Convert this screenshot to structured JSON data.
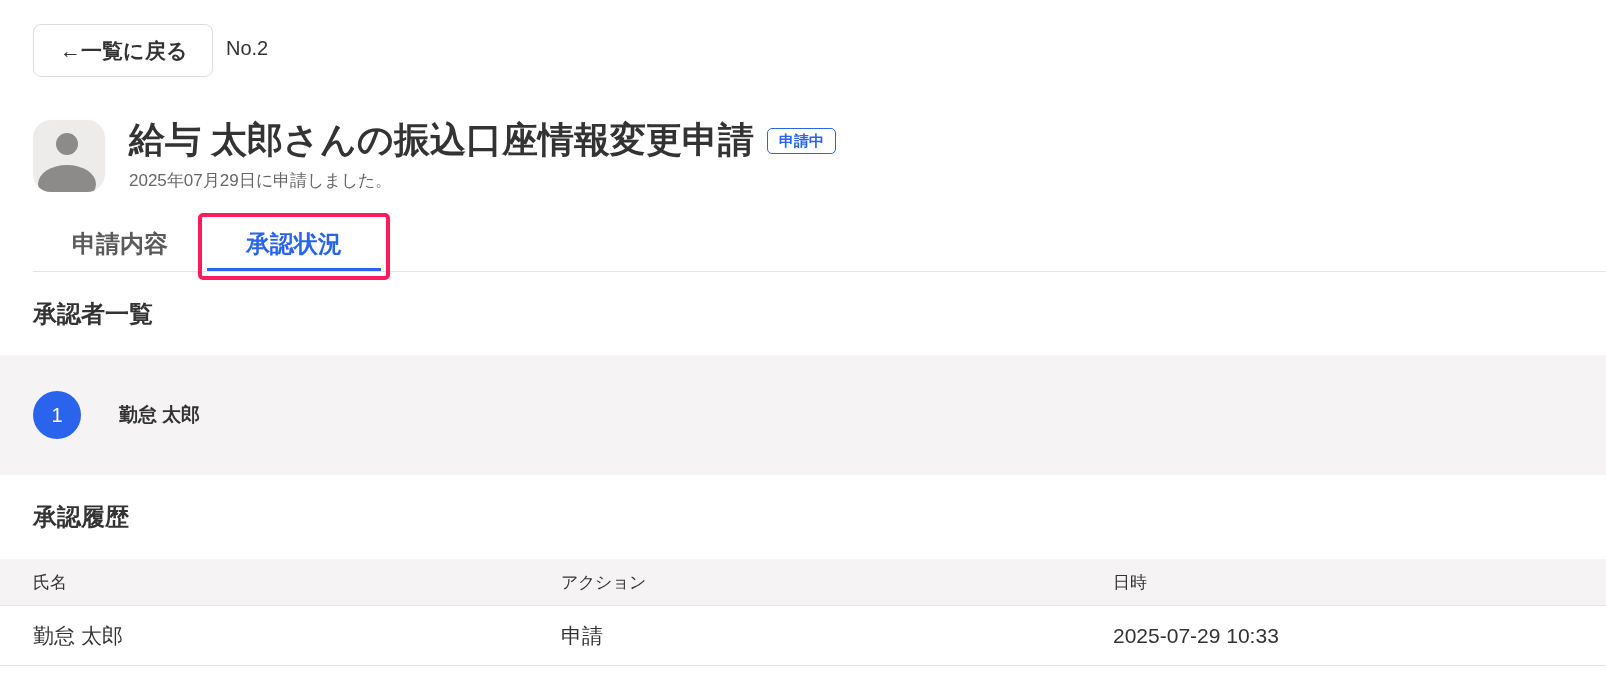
{
  "back_button": {
    "label": "←一覧に戻る"
  },
  "record_number": "No.2",
  "header": {
    "title": "給与 太郎さんの振込口座情報変更申請",
    "status_badge": "申請中",
    "subtitle": "2025年07月29日に申請しました。"
  },
  "tabs": [
    {
      "label": "申請内容",
      "selected": false,
      "highlighted": false
    },
    {
      "label": "承認状況",
      "selected": true,
      "highlighted": true
    }
  ],
  "approvers": {
    "heading": "承認者一覧",
    "items": [
      {
        "step": "1",
        "name": "勤怠 太郎"
      }
    ]
  },
  "history": {
    "heading": "承認履歴",
    "columns": [
      "氏名",
      "アクション",
      "日時"
    ],
    "rows": [
      [
        "勤怠 太郎",
        "申請",
        "2025-07-29 10:33"
      ]
    ]
  }
}
